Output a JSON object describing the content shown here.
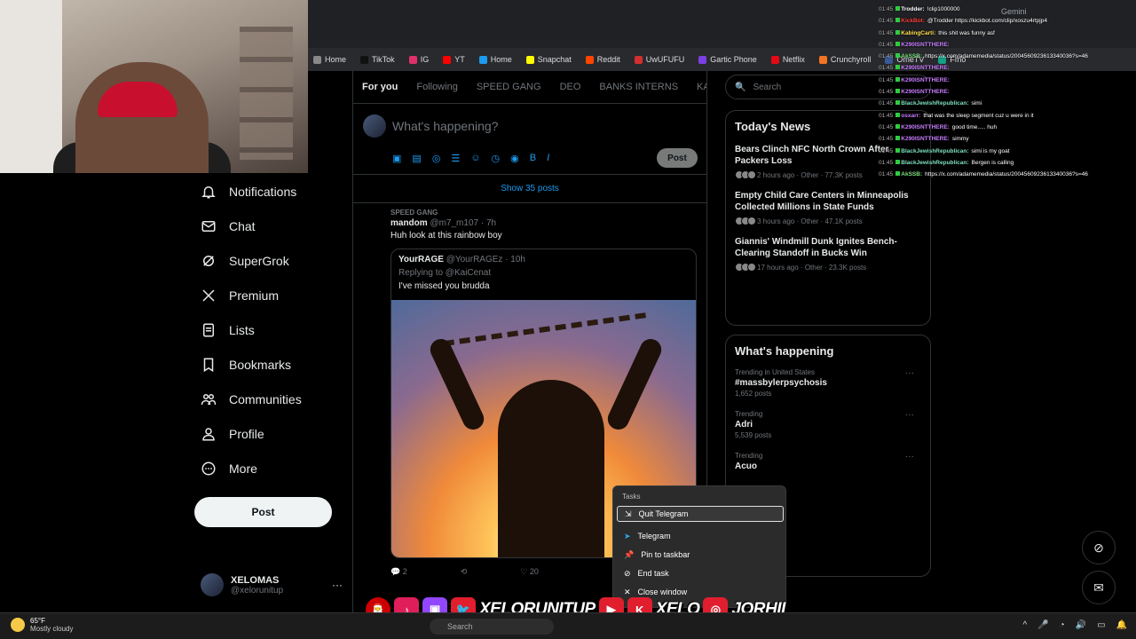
{
  "bookmarks": [
    "Home",
    "TikTok",
    "IG",
    "YT",
    "Home",
    "Snapchat",
    "Reddit",
    "UwUFUFU",
    "Gartic Phone",
    "Netflix",
    "Crunchyroll",
    "OmeTV",
    "Fmo"
  ],
  "bookmark_colors": [
    "#888888",
    "#111111",
    "#e1306c",
    "#ff0000",
    "#1d9bf0",
    "#fffc00",
    "#ff4500",
    "#d32f2f",
    "#7b3fe4",
    "#e50914",
    "#f47521",
    "#3b5998",
    "#16a085"
  ],
  "nav": {
    "items": [
      "Notifications",
      "Chat",
      "SuperGrok",
      "Premium",
      "Lists",
      "Bookmarks",
      "Communities",
      "Profile",
      "More"
    ],
    "post_label": "Post"
  },
  "account": {
    "name": "XELOMAS",
    "handle": "@xelorunitup"
  },
  "feed": {
    "tabs": [
      "For you",
      "Following",
      "SPEED GANG",
      "DEO",
      "BANKS INTERNS",
      "KAI MAI"
    ],
    "composer_placeholder": "What's happening?",
    "composer_post": "Post",
    "show_posts": "Show 35 posts"
  },
  "tweet": {
    "context": "SPEED GANG",
    "name": "mandom",
    "handle": "@m7_m107 · 7h",
    "text": "Huh look at this rainbow boy",
    "quote": {
      "name": "YourRAGE",
      "handle": "@YourRAGEz · 10h",
      "replying": "Replying to @KaiCenat",
      "text": "I've missed you brudda"
    },
    "actions": {
      "replies": "2",
      "likes": "20"
    }
  },
  "search_placeholder": "Search",
  "news": {
    "title": "Today's News",
    "items": [
      {
        "title": "Bears Clinch NFC North Crown After Packers Loss",
        "meta": "2 hours ago · Other · 77.3K posts"
      },
      {
        "title": "Empty Child Care Centers in Minneapolis Collected Millions in State Funds",
        "meta": "3 hours ago · Other · 47.1K posts"
      },
      {
        "title": "Giannis' Windmill Dunk Ignites Bench-Clearing Standoff in Bucks Win",
        "meta": "17 hours ago · Other · 23.3K posts"
      }
    ]
  },
  "happening": {
    "title": "What's happening",
    "trends": [
      {
        "context": "Trending in United States",
        "name": "#massbylerpsychosis",
        "posts": "1,652 posts"
      },
      {
        "context": "Trending",
        "name": "Adri",
        "posts": "5,539 posts"
      },
      {
        "context": "Trending",
        "name": "Acuo",
        "posts": ""
      }
    ]
  },
  "chat": [
    {
      "ts": "01:45",
      "user": "Trodder:",
      "color": "#ffffff",
      "msg": "!clip1000000"
    },
    {
      "ts": "01:45",
      "user": "KickBot:",
      "color": "#ff3b3b",
      "msg": "@Trodder https://kickbot.com/clip/xoszu4rtpjp4"
    },
    {
      "ts": "01:45",
      "user": "KabingCarti:",
      "color": "#ffde4a",
      "msg": "this shit was funny asf"
    },
    {
      "ts": "01:45",
      "user": "K290ISNTTHERE:",
      "color": "#c77dff",
      "msg": ""
    },
    {
      "ts": "01:45",
      "user": "AkSSB:",
      "color": "#7ee081",
      "msg": "https://x.com/adamemedia/status/2004560923613340036?s=46"
    },
    {
      "ts": "01:45",
      "user": "K290ISNTTHERE:",
      "color": "#c77dff",
      "msg": ""
    },
    {
      "ts": "01:45",
      "user": "K290ISNTTHERE:",
      "color": "#c77dff",
      "msg": ""
    },
    {
      "ts": "01:45",
      "user": "K290ISNTTHERE:",
      "color": "#c77dff",
      "msg": ""
    },
    {
      "ts": "01:45",
      "user": "BlackJewishRepublican:",
      "color": "#7ee0c0",
      "msg": "simi"
    },
    {
      "ts": "01:45",
      "user": "osxarr:",
      "color": "#c77dff",
      "msg": "that was the sleep segment cuz u were in it"
    },
    {
      "ts": "01:45",
      "user": "K290ISNTTHERE:",
      "color": "#c77dff",
      "msg": "good time..... huh"
    },
    {
      "ts": "01:45",
      "user": "K290ISNTTHERE:",
      "color": "#c77dff",
      "msg": "simmy"
    },
    {
      "ts": "01:45",
      "user": "BlackJewishRepublican:",
      "color": "#7ee0c0",
      "msg": "simi is my goat"
    },
    {
      "ts": "01:45",
      "user": "BlackJewishRepublican:",
      "color": "#7ee0c0",
      "msg": "Bergen is calling"
    },
    {
      "ts": "01:45",
      "user": "AkSSB:",
      "color": "#7ee081",
      "msg": "https://x.com/adamemedia/status/2004560923613340036?s=46"
    }
  ],
  "gemini": "Gemini",
  "context_menu": {
    "header": "Tasks",
    "items": [
      "Quit Telegram",
      "Telegram",
      "Pin to taskbar",
      "End task",
      "Close window"
    ]
  },
  "banner": {
    "text1": "XELORUNITUP",
    "text2": "XELO",
    "text3": "JORHII"
  },
  "taskbar": {
    "temp": "65°F",
    "condition": "Mostly cloudy",
    "search": "Search"
  }
}
